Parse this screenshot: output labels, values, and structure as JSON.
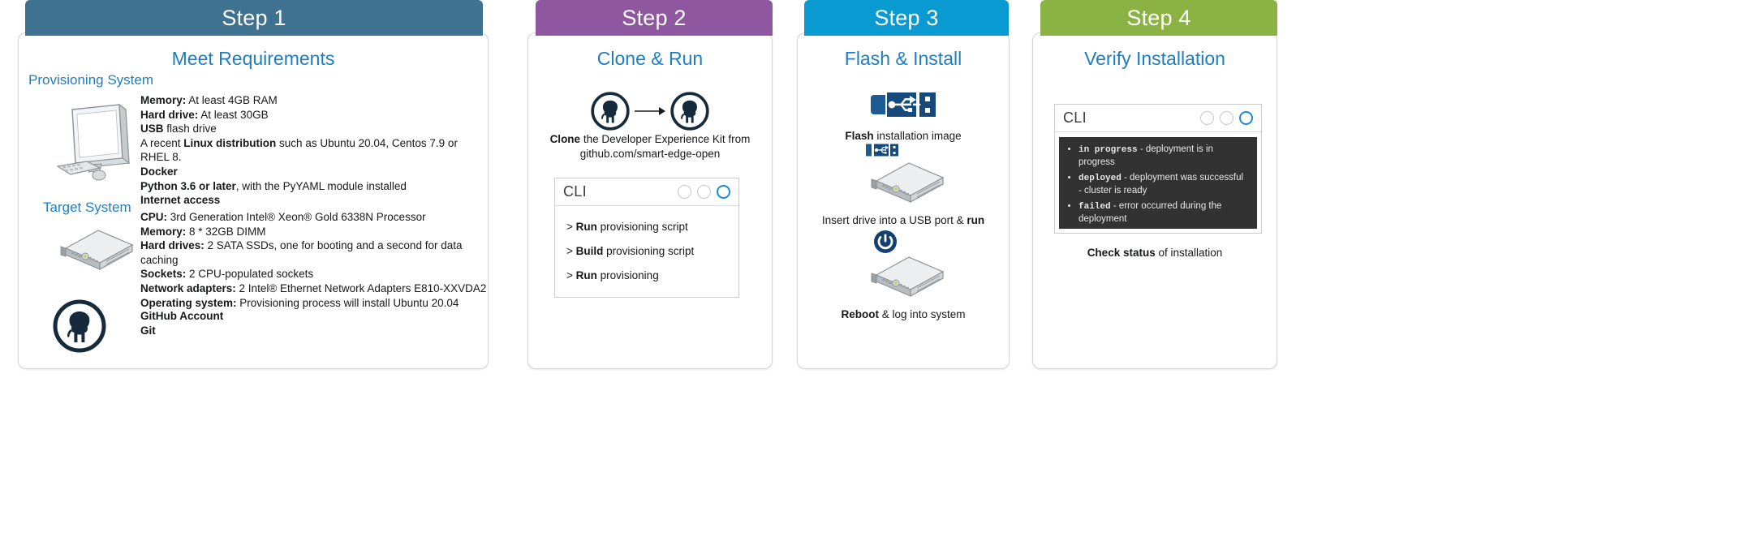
{
  "colors": {
    "step1_header": "#3f7190",
    "step2_header": "#8e579f",
    "step3_header": "#0a9ad2",
    "step4_header": "#8ab343",
    "title_blue": "#1f7dc0",
    "cli_active_dot": "#1b8ad6",
    "console_bg": "#323232",
    "usb_icon": "#164a7d"
  },
  "steps": [
    {
      "header": "Step 1",
      "title": "Meet Requirements",
      "provisioning": {
        "label": "Provisioning System",
        "icon": "desktop-computer-icon",
        "specs": [
          {
            "term": "Memory:",
            "desc": " At least 4GB RAM"
          },
          {
            "term": "Hard drive:",
            "desc": " At least 30GB"
          },
          {
            "term": "USB",
            "desc": " flash drive"
          },
          {
            "pre": "A recent ",
            "term": "Linux distribution",
            "desc": " such as Ubuntu 20.04, Centos 7.9 or RHEL 8."
          },
          {
            "term": "Docker",
            "desc": ""
          },
          {
            "term": "Python 3.6 or later",
            "desc": ", with the PyYAML module installed"
          },
          {
            "term": "Internet access",
            "desc": ""
          }
        ]
      },
      "target": {
        "label": "Target System",
        "icon": "rack-server-icon",
        "specs": [
          {
            "term": "CPU:",
            "desc": " 3rd Generation Intel® Xeon® Gold 6338N Processor"
          },
          {
            "term": "Memory:",
            "desc": " 8 * 32GB DIMM"
          },
          {
            "term": "Hard drives:",
            "desc": " 2 SATA SSDs, one for booting and a second for data caching"
          },
          {
            "term": "Sockets:",
            "desc": " 2 CPU-populated sockets"
          },
          {
            "term": "Network adapters:",
            "desc": " 2 Intel® Ethernet Network Adapters E810-XXVDA2"
          },
          {
            "term": "Operating system:",
            "desc": "  Provisioning process will install Ubuntu 20.04"
          }
        ]
      },
      "github": {
        "icon": "github-icon",
        "specs": [
          {
            "term": "GitHub Account",
            "desc": ""
          },
          {
            "term": "Git",
            "desc": ""
          }
        ]
      }
    },
    {
      "header": "Step 2",
      "title": "Clone & Run",
      "diagram_icons": [
        "github-icon",
        "arrow-right-icon",
        "github-icon"
      ],
      "caption_bold": "Clone",
      "caption_rest": " the Developer Experience Kit from",
      "caption_line2": "github.com/smart-edge-open",
      "cli": {
        "title": "CLI",
        "dots": [
          "inactive",
          "inactive",
          "active"
        ],
        "lines": [
          {
            "prompt": ">",
            "bold": "Run",
            "rest": " provisioning script"
          },
          {
            "prompt": ">",
            "bold": "Build",
            "rest": " provisioning script"
          },
          {
            "prompt": ">",
            "bold": "Run",
            "rest": " provisioning"
          }
        ]
      }
    },
    {
      "header": "Step 3",
      "title": "Flash & Install",
      "blocks": [
        {
          "icon": "usb-drive-icon",
          "caption_bold": "Flash",
          "caption_rest": " installation image"
        },
        {
          "icon": "rack-server-usb-icon",
          "caption_bold": "",
          "caption_rest": "Insert drive into a USB port & ",
          "caption_bold_end": "run"
        },
        {
          "icon": "rack-server-power-icon",
          "caption_bold": "Reboot",
          "caption_rest": " & log into system"
        }
      ]
    },
    {
      "header": "Step 4",
      "title": "Verify Installation",
      "cli": {
        "title": "CLI",
        "dots": [
          "inactive",
          "inactive",
          "active"
        ],
        "console_items": [
          {
            "kw": "in progress",
            "desc": " - deployment is in progress"
          },
          {
            "kw": "deployed",
            "desc": " - deployment was successful -  cluster is ready"
          },
          {
            "kw": "failed",
            "desc": " - error occurred during the deployment"
          }
        ]
      },
      "caption_bold": "Check status",
      "caption_rest": " of installation"
    }
  ]
}
